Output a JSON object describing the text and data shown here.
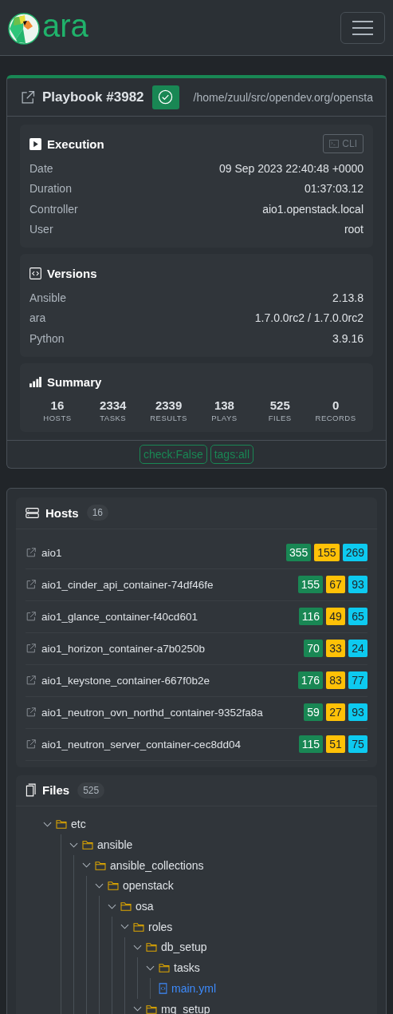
{
  "navbar": {
    "brand": "ara"
  },
  "playbook": {
    "title": "Playbook #3982",
    "succeeded": true,
    "path": "/home/zuul/src/opendev.org/opensta",
    "execution": {
      "title": "Execution",
      "cli_button": "CLI",
      "rows": [
        {
          "label": "Date",
          "value": "09 Sep 2023 22:40:48 +0000"
        },
        {
          "label": "Duration",
          "value": "01:37:03.12"
        },
        {
          "label": "Controller",
          "value": "aio1.openstack.local"
        },
        {
          "label": "User",
          "value": "root"
        }
      ]
    },
    "versions": {
      "title": "Versions",
      "rows": [
        {
          "label": "Ansible",
          "value": "2.13.8"
        },
        {
          "label": "ara",
          "value": "1.7.0.0rc2 / 1.7.0.0rc2"
        },
        {
          "label": "Python",
          "value": "3.9.16"
        }
      ]
    },
    "summary": {
      "title": "Summary",
      "stats": [
        {
          "value": "16",
          "label": "HOSTS"
        },
        {
          "value": "2334",
          "label": "TASKS"
        },
        {
          "value": "2339",
          "label": "RESULTS"
        },
        {
          "value": "138",
          "label": "PLAYS"
        },
        {
          "value": "525",
          "label": "FILES"
        },
        {
          "value": "0",
          "label": "RECORDS"
        }
      ]
    },
    "tags": [
      "check:False",
      "tags:all"
    ]
  },
  "hosts": {
    "title": "Hosts",
    "count": "16",
    "rows": [
      {
        "name": "aio1",
        "counts": [
          "355",
          "155",
          "269"
        ]
      },
      {
        "name": "aio1_cinder_api_container-74df46fe",
        "counts": [
          "155",
          "67",
          "93"
        ]
      },
      {
        "name": "aio1_glance_container-f40cd601",
        "counts": [
          "116",
          "49",
          "65"
        ]
      },
      {
        "name": "aio1_horizon_container-a7b0250b",
        "counts": [
          "70",
          "33",
          "24"
        ]
      },
      {
        "name": "aio1_keystone_container-667f0b2e",
        "counts": [
          "176",
          "83",
          "77"
        ]
      },
      {
        "name": "aio1_neutron_ovn_northd_container-9352fa8a",
        "counts": [
          "59",
          "27",
          "93"
        ]
      },
      {
        "name": "aio1_neutron_server_container-cec8dd04",
        "counts": [
          "115",
          "51",
          "75"
        ]
      }
    ]
  },
  "files": {
    "title": "Files",
    "count": "525",
    "tree": [
      {
        "kind": "folder",
        "name": "etc",
        "expanded": true,
        "children": [
          {
            "kind": "folder",
            "name": "ansible",
            "expanded": true,
            "children": [
              {
                "kind": "folder",
                "name": "ansible_collections",
                "expanded": true,
                "children": [
                  {
                    "kind": "folder",
                    "name": "openstack",
                    "expanded": true,
                    "children": [
                      {
                        "kind": "folder",
                        "name": "osa",
                        "expanded": true,
                        "children": [
                          {
                            "kind": "folder",
                            "name": "roles",
                            "expanded": true,
                            "children": [
                              {
                                "kind": "folder",
                                "name": "db_setup",
                                "expanded": true,
                                "children": [
                                  {
                                    "kind": "folder",
                                    "name": "tasks",
                                    "expanded": true,
                                    "children": [
                                      {
                                        "kind": "file",
                                        "name": "main.yml"
                                      }
                                    ]
                                  }
                                ]
                              },
                              {
                                "kind": "folder",
                                "name": "mq_setup",
                                "expanded": true
                              }
                            ]
                          }
                        ]
                      }
                    ]
                  }
                ]
              }
            ]
          }
        ]
      }
    ]
  }
}
